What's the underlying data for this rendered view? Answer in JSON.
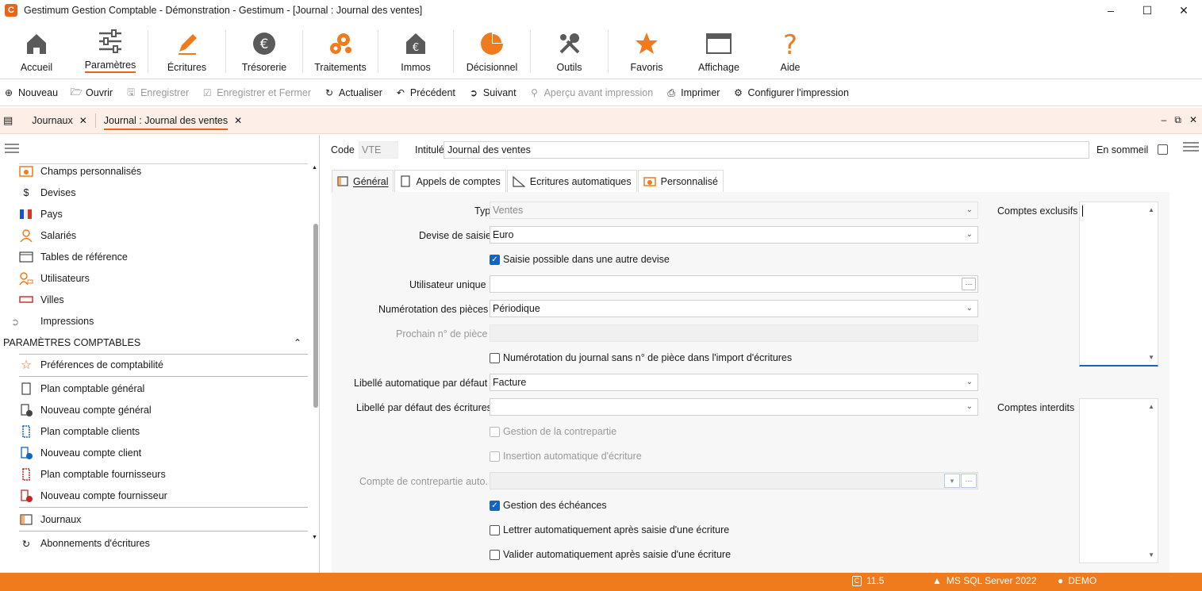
{
  "window": {
    "title": "Gestimum Gestion Comptable - Démonstration - Gestimum - [Journal : Journal des ventes]",
    "logo": "C"
  },
  "ribbon": [
    {
      "label": "Accueil",
      "icon": "home-icon"
    },
    {
      "label": "Paramètres",
      "icon": "sliders-icon"
    },
    {
      "label": "Écritures",
      "icon": "pencil-icon"
    },
    {
      "label": "Trésorerie",
      "icon": "euro-coin-icon"
    },
    {
      "label": "Traitements",
      "icon": "gears-icon"
    },
    {
      "label": "Immos",
      "icon": "euro-house-icon"
    },
    {
      "label": "Décisionnel",
      "icon": "pie-chart-icon"
    },
    {
      "label": "Outils",
      "icon": "tools-icon"
    },
    {
      "label": "Favoris",
      "icon": "star-icon"
    },
    {
      "label": "Affichage",
      "icon": "window-icon"
    },
    {
      "label": "Aide",
      "icon": "question-icon"
    }
  ],
  "toolbar": {
    "new": "Nouveau",
    "open": "Ouvrir",
    "save": "Enregistrer",
    "save_close": "Enregistrer et Fermer",
    "refresh": "Actualiser",
    "previous": "Précédent",
    "next": "Suivant",
    "preview": "Aperçu avant impression",
    "print": "Imprimer",
    "print_config": "Configurer l'impression"
  },
  "doc_tabs": [
    "Journaux",
    "Journal : Journal des ventes"
  ],
  "sidebar": {
    "items_top": [
      "Champs personnalisés",
      "Devises",
      "Pays",
      "Salariés",
      "Tables de référence",
      "Utilisateurs",
      "Villes",
      "Impressions"
    ],
    "section": "PARAMÈTRES COMPTABLES",
    "items_bottom": [
      "Préférences de comptabilité",
      "Plan comptable général",
      "Nouveau compte général",
      "Plan comptable clients",
      "Nouveau compte client",
      "Plan comptable fournisseurs",
      "Nouveau compte fournisseur",
      "Journaux",
      "Abonnements d'écritures"
    ]
  },
  "form": {
    "code_label": "Code",
    "code_value": "VTE",
    "intitule_label": "Intitulé",
    "intitule_value": "Journal des ventes",
    "sommeil_label": "En sommeil",
    "tabs": [
      "Général",
      "Appels de comptes",
      "Ecritures automatiques",
      "Personnalisé"
    ],
    "type_label": "Type",
    "type_value": "Ventes",
    "devise_label": "Devise de saisie",
    "devise_value": "Euro",
    "saisie_autre_devise": "Saisie possible dans une autre devise",
    "utilisateur_label": "Utilisateur unique",
    "utilisateur_value": "",
    "ellipsis": "···",
    "numerotation_label": "Numérotation des pièces",
    "numerotation_value": "Périodique",
    "prochain_label": "Prochain n° de pièce",
    "numerotation_import": "Numérotation du journal sans n° de pièce dans l'import d'écritures",
    "libelle_auto_label": "Libellé automatique par défaut",
    "libelle_auto_value": "Facture",
    "libelle_ecr_label": "Libellé par défaut des écritures",
    "gestion_contrepartie": "Gestion de la contrepartie",
    "insertion_auto": "Insertion automatique d'écriture",
    "compte_contrepartie_label": "Compte de contrepartie auto.",
    "gestion_echeances": "Gestion des échéances",
    "lettrer_auto": "Lettrer automatiquement après saisie d'une écriture",
    "valider_auto": "Valider automatiquement après saisie d'une écriture",
    "comptes_exclusifs": "Comptes exclusifs",
    "comptes_interdits": "Comptes interdits"
  },
  "status": {
    "version": "11.5",
    "server": "MS SQL Server 2022",
    "user": "DEMO"
  },
  "colors": {
    "accent": "#e8641b",
    "status_bg": "#ef7b1d",
    "tab_bar": "#fdeee8"
  }
}
